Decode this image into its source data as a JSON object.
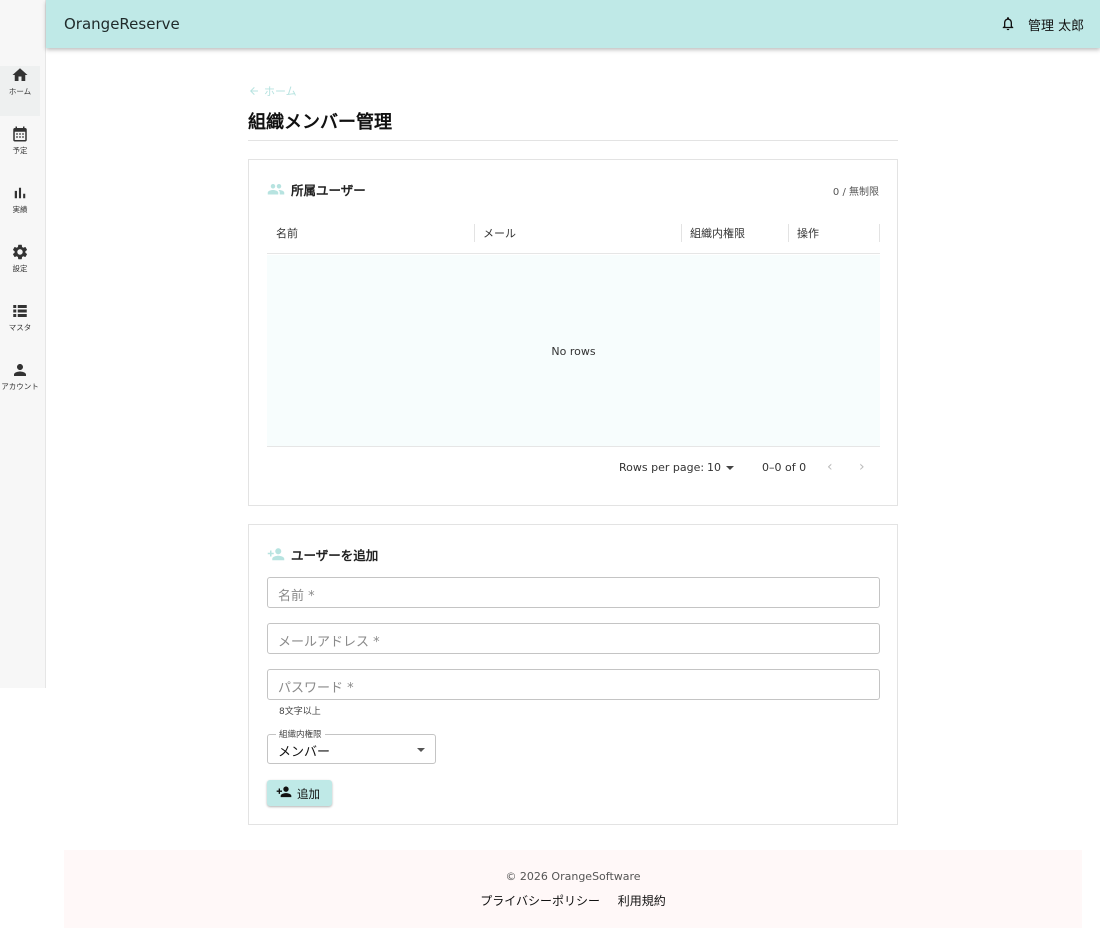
{
  "app": {
    "title": "OrangeReserve",
    "user_name": "管理 太郎"
  },
  "sidebar": {
    "items": [
      {
        "label": "ホーム",
        "icon": "home-icon"
      },
      {
        "label": "予定",
        "icon": "calendar-icon"
      },
      {
        "label": "実績",
        "icon": "bar-chart-icon"
      },
      {
        "label": "設定",
        "icon": "gear-icon"
      },
      {
        "label": "マスタ",
        "icon": "list-icon"
      },
      {
        "label": "アカウント",
        "icon": "person-icon"
      }
    ]
  },
  "breadcrumb": {
    "back_label": "ホーム"
  },
  "page": {
    "title": "組織メンバー管理"
  },
  "members": {
    "heading": "所属ユーザー",
    "quota": "0 / 無制限",
    "columns": [
      "名前",
      "メール",
      "組織内権限",
      "操作"
    ],
    "rows": [],
    "empty_text": "No rows",
    "pagination": {
      "rows_per_page_label": "Rows per page:",
      "rows_per_page": "10",
      "range": "0–0 of 0"
    }
  },
  "add_user": {
    "heading": "ユーザーを追加",
    "name_placeholder": "名前 *",
    "email_placeholder": "メールアドレス *",
    "password_placeholder": "パスワード *",
    "password_helper": "8文字以上",
    "role_label": "組織内権限",
    "role_value": "メンバー",
    "submit_label": "追加"
  },
  "footer": {
    "copyright": "© 2026 OrangeSoftware",
    "links": [
      "プライバシーポリシー",
      "利用規約"
    ]
  },
  "colors": {
    "accent": "#bfe9e7",
    "icon_accent": "#b7e3e0",
    "footer_bg": "#fff8f8"
  }
}
